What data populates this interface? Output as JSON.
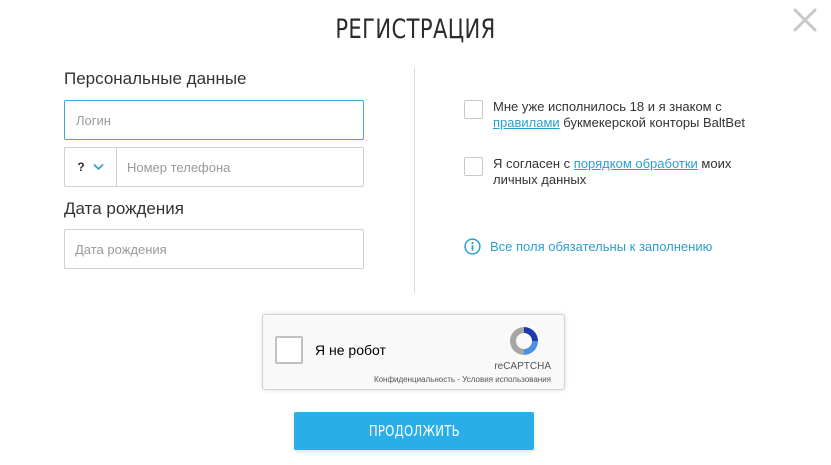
{
  "modal": {
    "title": "РЕГИСТРАЦИЯ",
    "close_icon": "close-icon"
  },
  "personal": {
    "label": "Персональные данные",
    "login_placeholder": "Логин",
    "phone_code": "?",
    "phone_placeholder": "Номер телефона"
  },
  "birth": {
    "label": "Дата рождения",
    "placeholder": "Дата рождения"
  },
  "agreements": {
    "age": {
      "prefix": "Мне уже исполнилось 18 и я знаком с ",
      "link": "правилами",
      "suffix": " букмекерской конторы BaltBet"
    },
    "data": {
      "prefix": "Я согласен с ",
      "link": "порядком обработки",
      "suffix": " моих личных данных"
    }
  },
  "info": {
    "text": "Все поля обязательны к заполнению",
    "icon": "info-icon"
  },
  "recaptcha": {
    "label": "Я не робот",
    "brand": "reCAPTCHA",
    "links": "Конфиденциальность - Условия использования"
  },
  "continue_button": "ПРОДОЛЖИТЬ",
  "colors": {
    "accent": "#2aaee8",
    "link": "#2a9fd0",
    "focus_border": "#3fa7d6"
  }
}
